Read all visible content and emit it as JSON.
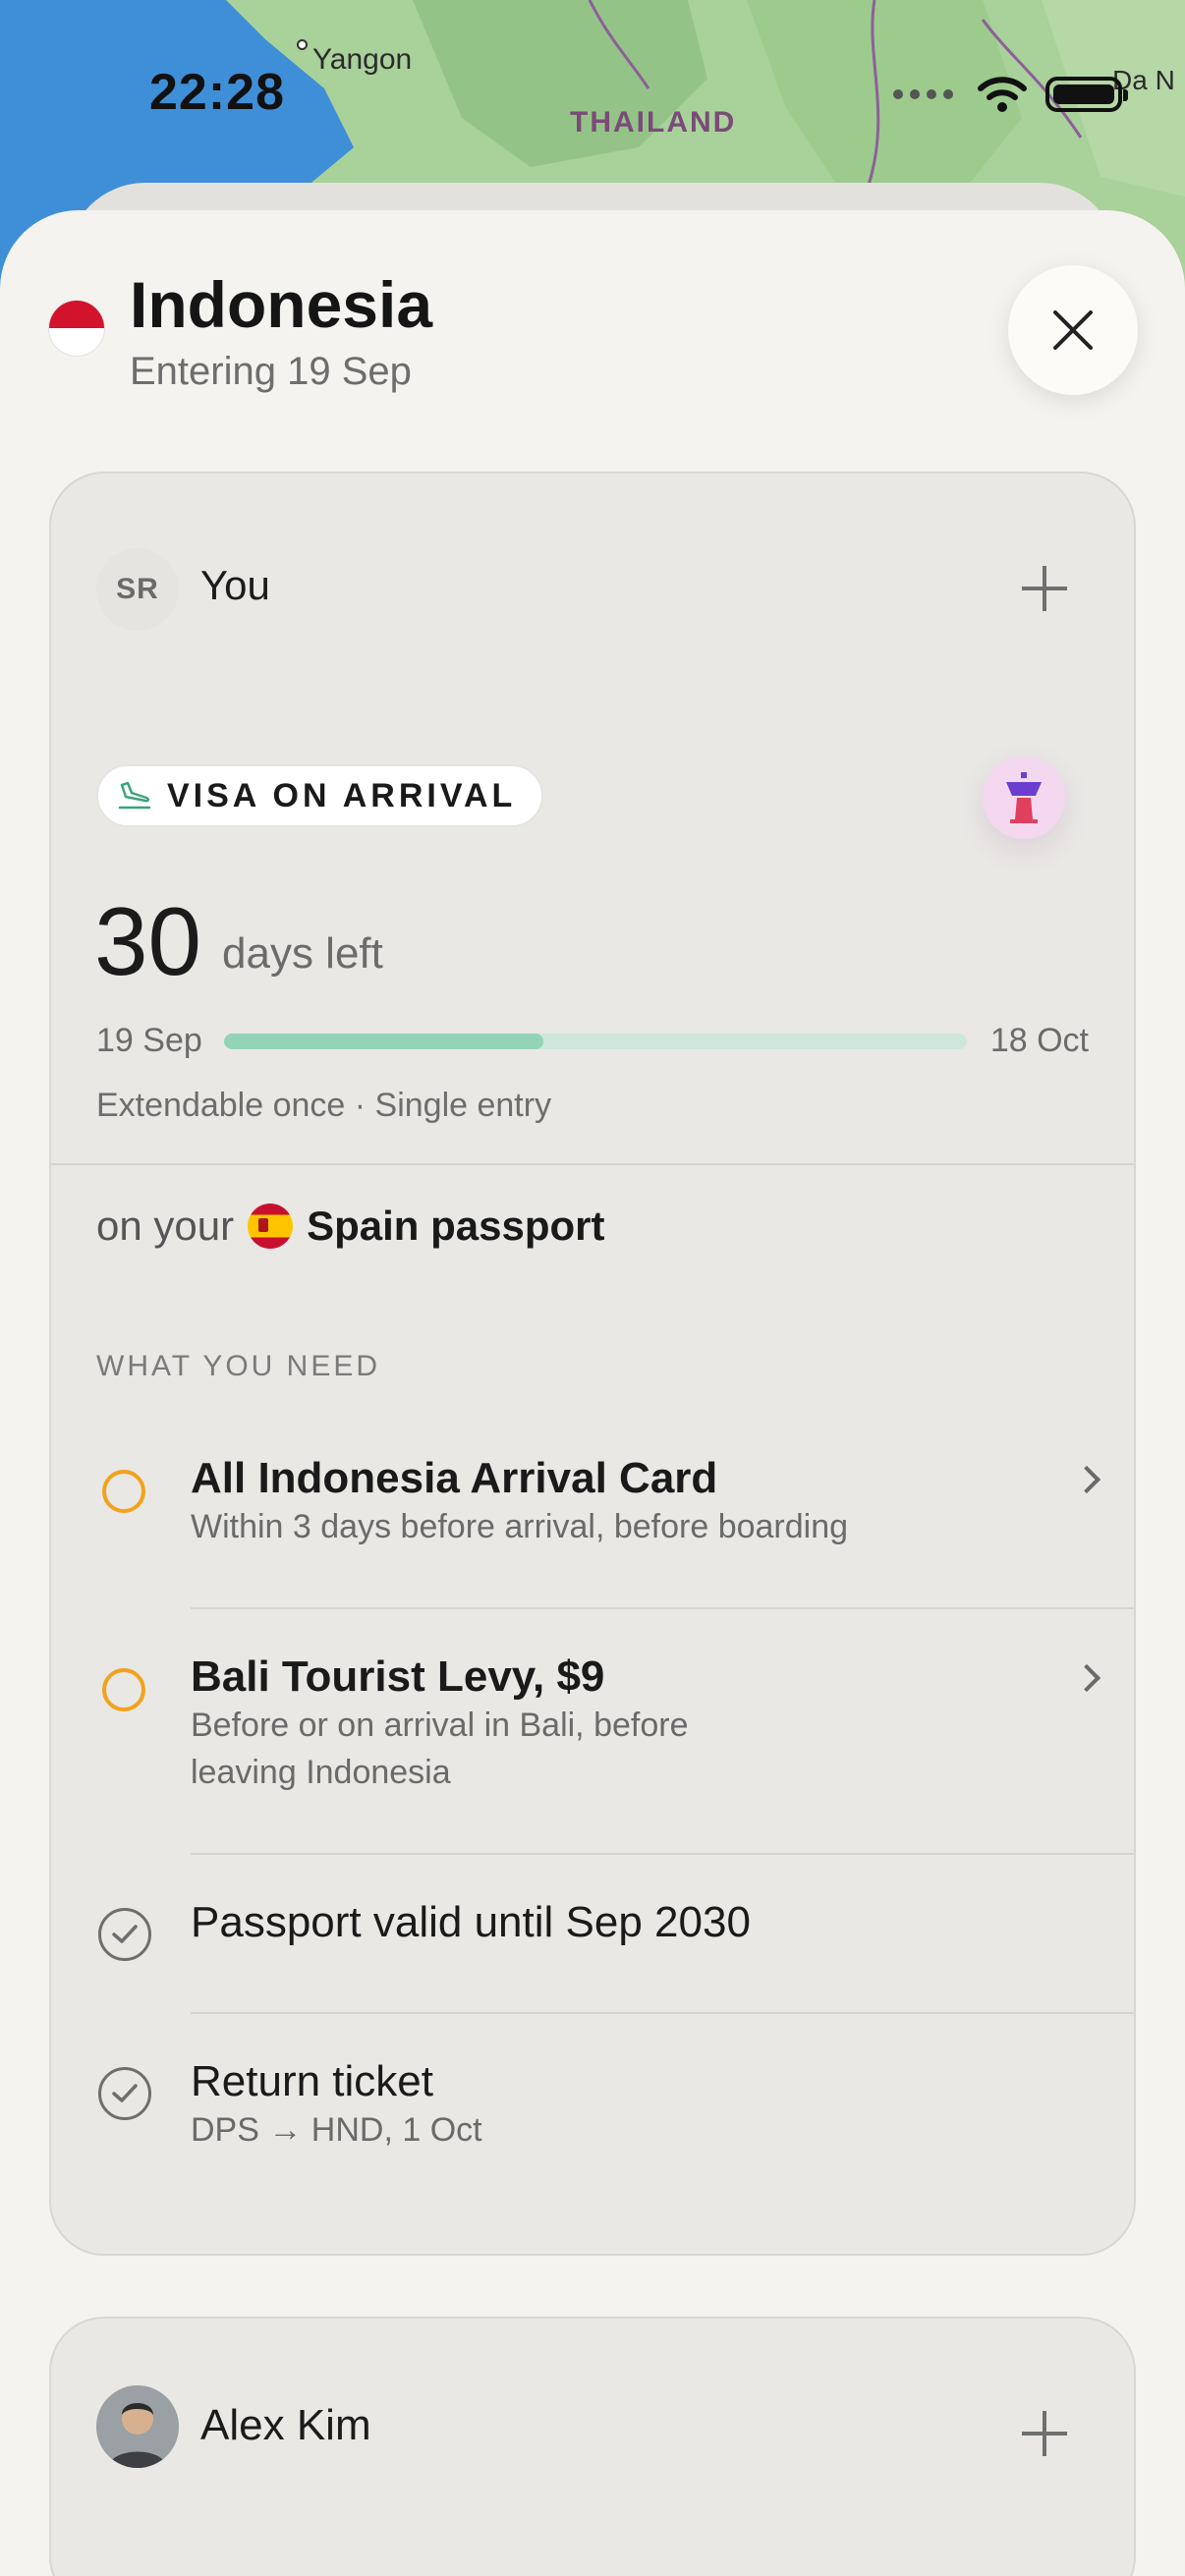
{
  "status_bar": {
    "time": "22:28"
  },
  "map": {
    "labels": {
      "city_1": "Yangon",
      "country": "THAILAND",
      "city_2": "Da N"
    }
  },
  "header": {
    "country": "Indonesia",
    "subtitle": "Entering 19 Sep",
    "flag_icon": "indonesia-flag",
    "close_icon": "close-icon"
  },
  "traveler_1": {
    "initials": "SR",
    "name": "You",
    "visa_type": "VISA ON ARRIVAL",
    "days_left_value": "30",
    "days_left_label": "days left",
    "start_date": "19 Sep",
    "end_date": "18 Oct",
    "progress_fraction": 0.43,
    "meta": "Extendable once · Single entry",
    "on_your": "on your",
    "passport": "Spain passport",
    "section_heading": "WHAT YOU NEED",
    "requirements": [
      {
        "title": "All Indonesia Arrival Card",
        "sub": "Within 3 days before arrival, before boarding",
        "status": "pending"
      },
      {
        "title": "Bali Tourist Levy, $9",
        "sub_line_1": "Before or on arrival in Bali, before",
        "sub_line_2": "leaving Indonesia",
        "status": "pending"
      },
      {
        "title": "Passport valid until Sep 2030",
        "status": "done"
      },
      {
        "title": "Return ticket",
        "sub": "DPS → HND, 1 Oct",
        "status": "done"
      }
    ]
  },
  "traveler_2": {
    "name": "Alex Kim"
  },
  "colors": {
    "pending": "#f2a21d",
    "progress": "#93d4b5",
    "progress_track": "#cfe6dc",
    "tower_bg": "#f4d8ef"
  }
}
